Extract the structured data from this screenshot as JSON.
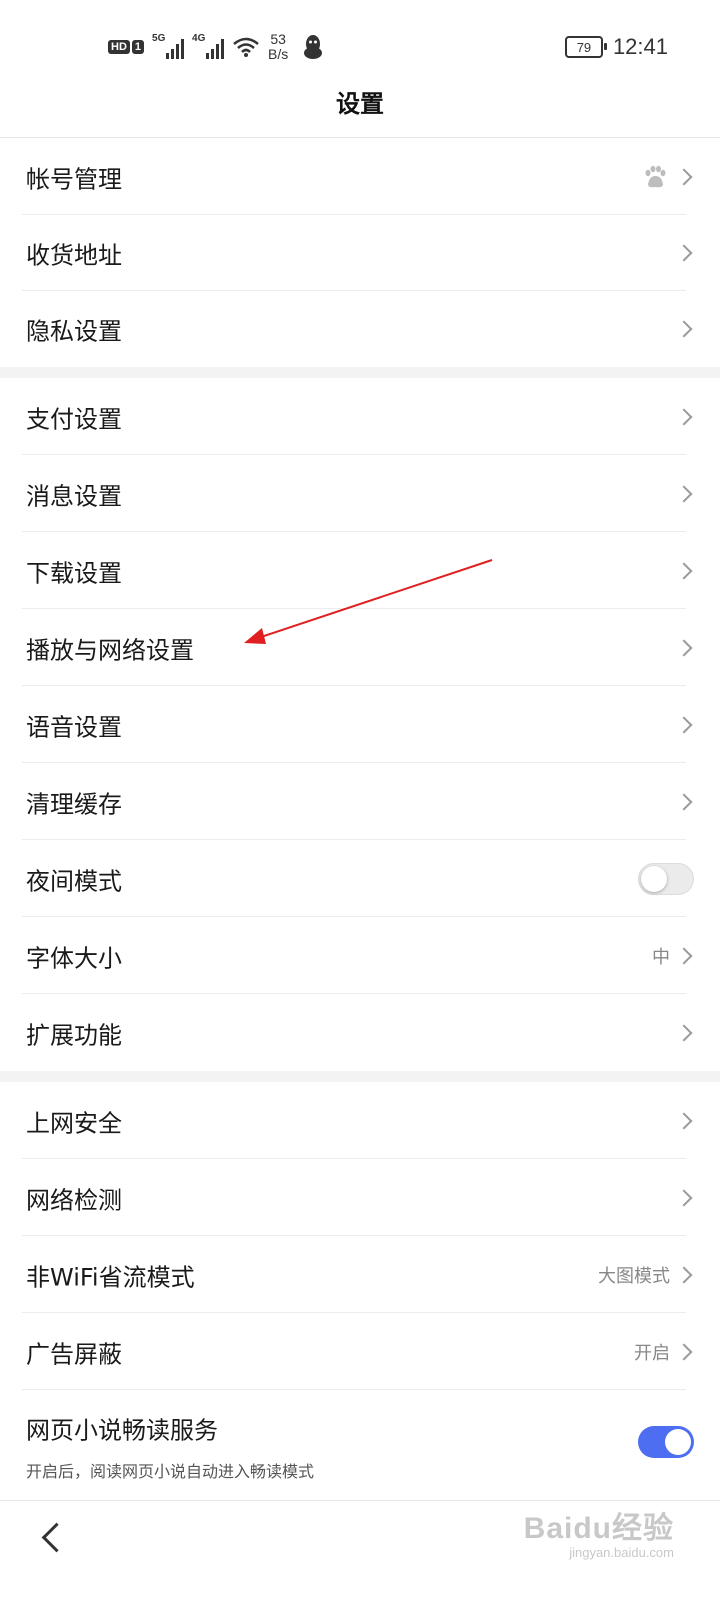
{
  "status_bar": {
    "hd_label": "HD",
    "sim_label": "1",
    "net1": "5G",
    "net2": "4G",
    "speed_value": "53",
    "speed_unit": "B/s",
    "battery": "79",
    "time": "12:41"
  },
  "header": {
    "title": "设置"
  },
  "groups": [
    {
      "items": [
        {
          "label": "帐号管理",
          "icon": "baidu-paw-icon"
        },
        {
          "label": "收货地址"
        },
        {
          "label": "隐私设置"
        }
      ]
    },
    {
      "items": [
        {
          "label": "支付设置"
        },
        {
          "label": "消息设置"
        },
        {
          "label": "下载设置"
        },
        {
          "label": "播放与网络设置"
        },
        {
          "label": "语音设置"
        },
        {
          "label": "清理缓存"
        },
        {
          "label": "夜间模式",
          "toggle": false
        },
        {
          "label": "字体大小",
          "value": "中"
        },
        {
          "label": "扩展功能"
        }
      ]
    },
    {
      "items": [
        {
          "label": "上网安全"
        },
        {
          "label": "网络检测"
        },
        {
          "label": "非WiFi省流模式",
          "value": "大图模式"
        },
        {
          "label": "广告屏蔽",
          "value": "开启"
        },
        {
          "label": "网页小说畅读服务",
          "sub": "开启后，阅读网页小说自动进入畅读模式",
          "toggle": true
        }
      ]
    }
  ],
  "watermark": {
    "line1": "Baidu经验",
    "line2": "jingyan.baidu.com"
  },
  "colors": {
    "accent": "#4e6ef2",
    "annotation_arrow": "#e02020"
  }
}
